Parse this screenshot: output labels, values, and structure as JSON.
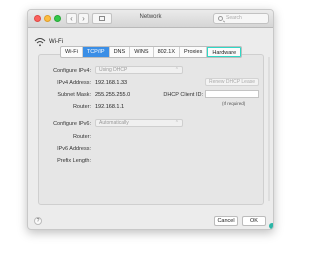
{
  "window": {
    "title": "Network"
  },
  "toolbar": {
    "back": "‹",
    "forward": "›",
    "search_placeholder": "Search"
  },
  "service": {
    "name": "Wi-Fi"
  },
  "tabs": [
    {
      "label": "Wi-Fi"
    },
    {
      "label": "TCP/IP"
    },
    {
      "label": "DNS"
    },
    {
      "label": "WINS"
    },
    {
      "label": "802.1X"
    },
    {
      "label": "Proxies"
    },
    {
      "label": "Hardware"
    }
  ],
  "ipv4": {
    "configure_label": "Configure IPv4:",
    "configure_value": "Using DHCP",
    "address_label": "IPv4 Address:",
    "address_value": "192.168.1.33",
    "renew_button": "Renew DHCP Lease",
    "subnet_label": "Subnet Mask:",
    "subnet_value": "255.255.255.0",
    "client_id_label": "DHCP Client ID:",
    "client_id_value": "",
    "client_id_hint": "(If required)",
    "router_label": "Router:",
    "router_value": "192.168.1.1"
  },
  "ipv6": {
    "configure_label": "Configure IPv6:",
    "configure_value": "Automatically",
    "router_label": "Router:",
    "address_label": "IPv6 Address:",
    "prefix_label": "Prefix Length:"
  },
  "footer": {
    "help": "?",
    "cancel": "Cancel",
    "ok": "OK"
  },
  "colors": {
    "selected_tab": "#3a8ee6",
    "highlight": "#2fd8c6"
  }
}
